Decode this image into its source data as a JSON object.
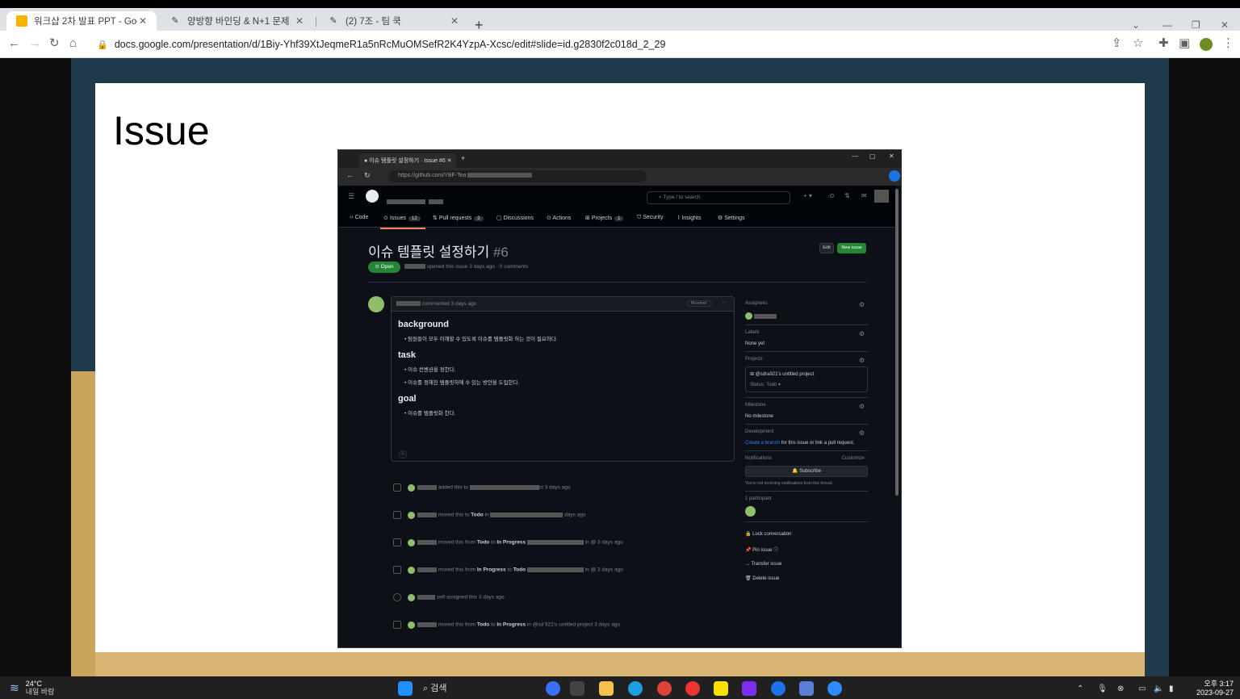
{
  "chrome": {
    "tabs": [
      {
        "label": "워크샵 2차 발표 PPT - Google",
        "icon": "google-slides-icon",
        "active": true
      },
      {
        "label": "양방향 바인딩 & N+1 문제",
        "icon": "notion-icon",
        "active": false
      },
      {
        "label": "(2) 7조 - 팀 쿡",
        "icon": "notion-icon",
        "active": false
      }
    ],
    "url": "docs.google.com/presentation/d/1Biy-Yhf39XtJeqmeR1a5nRcMuOMSefR2K4YzpA-Xcsc/edit#slide=id.g2830f2c018d_2_29"
  },
  "slide": {
    "title": "Issue"
  },
  "github": {
    "browser_tab": "이슈 템플릿 설정하기 · Issue #6",
    "url_prefix": "https://github.com/YBF-Tea",
    "search_placeholder": "Type / to search",
    "nav": [
      {
        "label": "Code",
        "count": ""
      },
      {
        "label": "Issues",
        "count": "12"
      },
      {
        "label": "Pull requests",
        "count": "3"
      },
      {
        "label": "Discussions",
        "count": ""
      },
      {
        "label": "Actions",
        "count": ""
      },
      {
        "label": "Projects",
        "count": "1"
      },
      {
        "label": "Security",
        "count": ""
      },
      {
        "label": "Insights",
        "count": ""
      },
      {
        "label": "Settings",
        "count": ""
      }
    ],
    "issue_title": "이슈 템플릿 설정하기",
    "issue_number": "#6",
    "edit_label": "Edit",
    "new_issue_label": "New issue",
    "status": "Open",
    "meta": "opened this issue 3 days ago · 0 comments",
    "comment": {
      "header": "commented 3 days ago",
      "member": "Member",
      "sections": [
        {
          "heading": "background",
          "items": [
            "팀원들이 모두 이해할 수 있도록 이슈를 템플릿화 하는 것이 필요하다."
          ]
        },
        {
          "heading": "task",
          "items": [
            "이슈 컨벤션을 정한다.",
            "이슈를 정해진 템플릿하에 수 있는 방안을 도입한다."
          ]
        },
        {
          "heading": "goal",
          "items": [
            "이슈를 템플릿화 한다."
          ]
        }
      ]
    },
    "timeline": [
      {
        "pre": "added this to",
        "b1": "",
        "mid": "",
        "b2": "",
        "post": "ct 3 days ago"
      },
      {
        "pre": "moved this to",
        "b1": "Todo",
        "mid": "in",
        "b2": "",
        "post": "days ago"
      },
      {
        "pre": "moved this from",
        "b1": "Todo",
        "mid": "to",
        "b2": "In Progress",
        "post": "in @ 3 days ago"
      },
      {
        "pre": "moved this from",
        "b1": "In Progress",
        "mid": "to",
        "b2": "Todo",
        "post": "in @ 3 days ago"
      },
      {
        "pre": "self-assigned this 3 days ago",
        "b1": "",
        "mid": "",
        "b2": "",
        "post": ""
      },
      {
        "pre": "moved this from",
        "b1": "Todo",
        "mid": "to",
        "b2": "In Progress",
        "post": "in @sd 921's untitled project 3 days ago"
      }
    ],
    "sidebar": {
      "assignees": "Assignees",
      "labels": "Labels",
      "labels_value": "None yet",
      "projects": "Projects",
      "project_name": "@sdra921's untitled project",
      "project_status": "Status: Todo",
      "milestone": "Milestone",
      "milestone_value": "No milestone",
      "development": "Development",
      "development_link": "Create a branch",
      "development_rest": "for this issue or link a pull request.",
      "notifications": "Notifications",
      "customize": "Customize",
      "subscribe": "Subscribe",
      "notif_note": "You're not receiving notifications from this thread.",
      "participants": "1 participant",
      "lock": "Lock conversation",
      "pin": "Pin issue",
      "transfer": "Transfer issue",
      "delete": "Delete issue"
    }
  },
  "taskbar": {
    "temp": "24°C",
    "weather": "내일 바람",
    "search": "검색",
    "time": "오후 3:17",
    "date": "2023-09-27"
  }
}
